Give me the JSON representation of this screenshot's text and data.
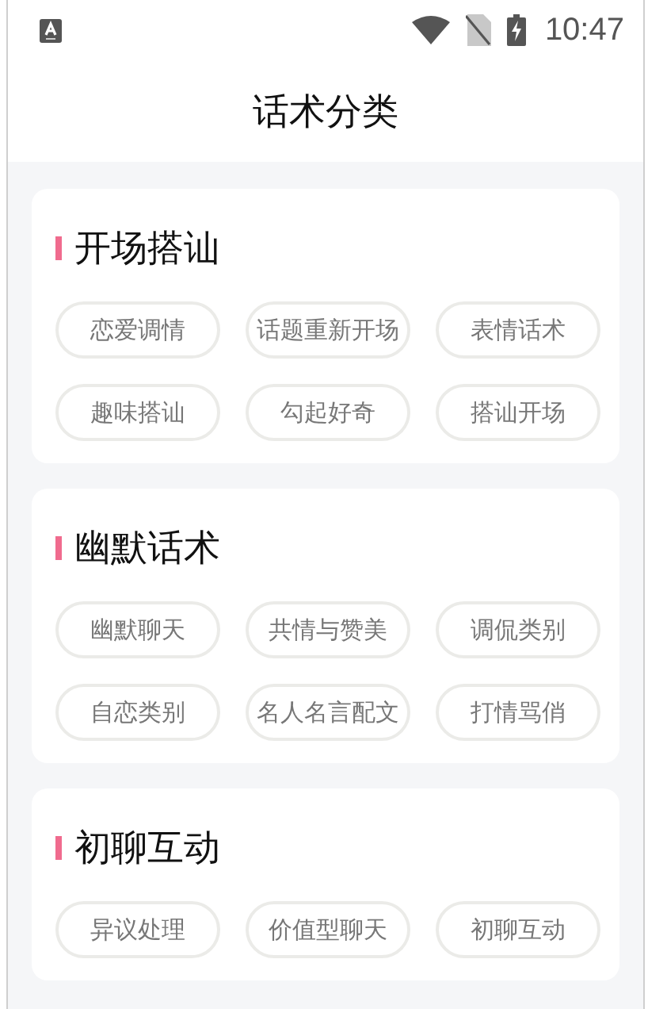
{
  "status_bar": {
    "time": "10:47"
  },
  "title": "话术分类",
  "sections": [
    {
      "title": "开场搭讪",
      "tags": [
        "恋爱调情",
        "话题重新开场",
        "表情话术",
        "趣味搭讪",
        "勾起好奇",
        "搭讪开场"
      ]
    },
    {
      "title": "幽默话术",
      "tags": [
        "幽默聊天",
        "共情与赞美",
        "调侃类别",
        "自恋类别",
        "名人名言配文",
        "打情骂俏"
      ]
    },
    {
      "title": "初聊互动",
      "tags": [
        "异议处理",
        "价值型聊天",
        "初聊互动"
      ]
    }
  ]
}
